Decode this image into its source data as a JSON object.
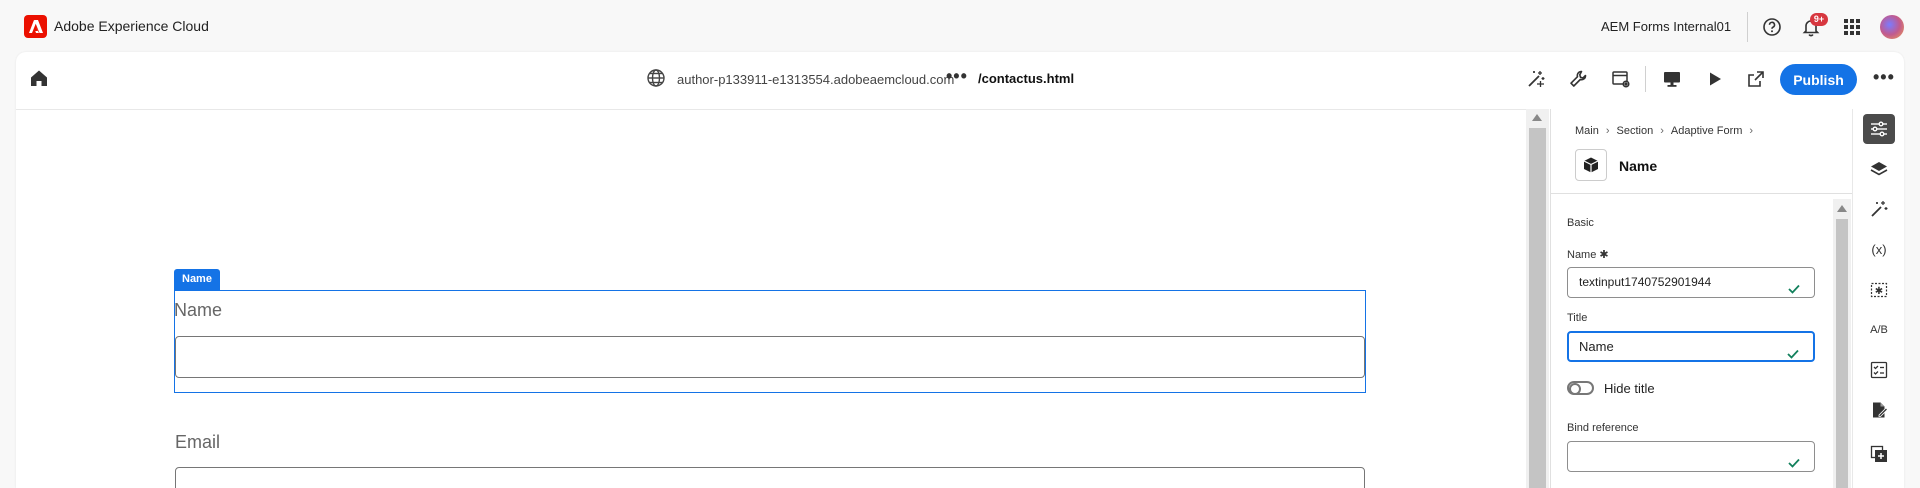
{
  "topbar": {
    "brand": "Adobe Experience Cloud",
    "org": "AEM Forms Internal01",
    "notification_count": "9+"
  },
  "toolbar": {
    "url_host": "author-p133911-e1313554.adobeaemcloud.com",
    "url_dots": "•••",
    "url_path": "/contactus.html",
    "publish_label": "Publish",
    "more_label": "•••"
  },
  "canvas": {
    "selected_tag": "Name",
    "fields": [
      {
        "label": "Name"
      },
      {
        "label": "Email"
      }
    ]
  },
  "properties": {
    "breadcrumb": [
      "Main",
      "Section",
      "Adaptive Form"
    ],
    "component_title": "Name",
    "section": "Basic",
    "name_label": "Name",
    "required_mark": "✱",
    "name_value": "textinput1740752901944",
    "title_label": "Title",
    "title_value": "Name",
    "hide_title_label": "Hide title",
    "bind_label": "Bind reference",
    "bind_value": ""
  },
  "rail": {
    "variables_label": "(x)",
    "ab_label": "A/B"
  },
  "colors": {
    "accent": "#1473e6",
    "adobe_red": "#eb1000",
    "check_green": "#12805c"
  }
}
